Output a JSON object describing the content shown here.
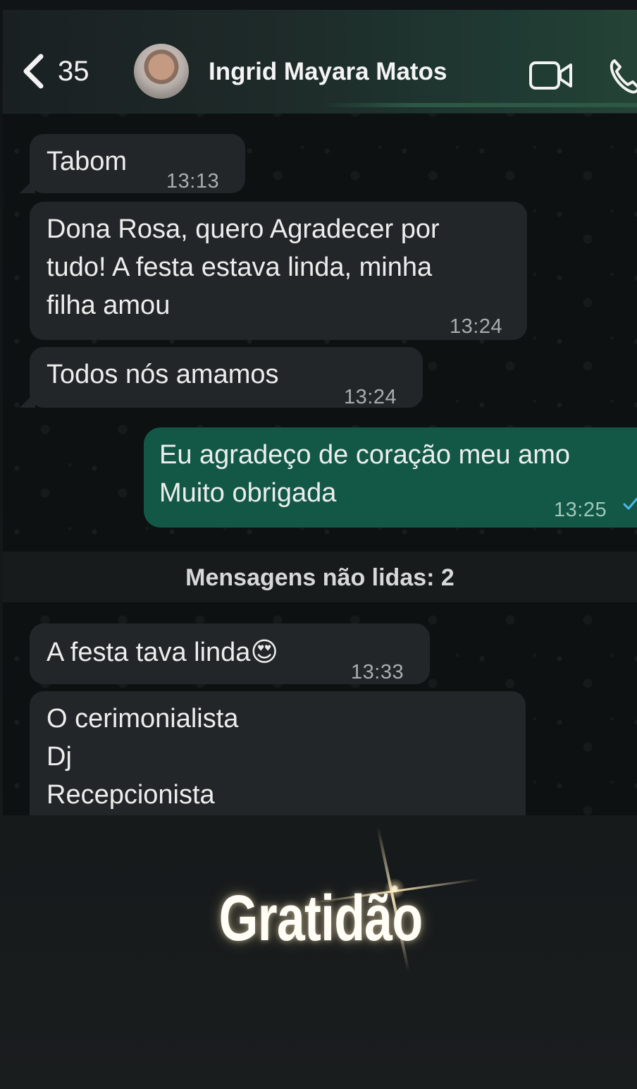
{
  "header": {
    "back_count": "35",
    "contact_name": "Ingrid Mayara Matos"
  },
  "messages": [
    {
      "direction": "in",
      "lines": [
        "Tabom"
      ],
      "time": "13:13"
    },
    {
      "direction": "in",
      "lines": [
        "Dona Rosa, quero Agradecer por",
        "tudo! A festa estava linda, minha",
        "filha amou"
      ],
      "time": "13:24"
    },
    {
      "direction": "in",
      "lines": [
        "Todos nós amamos"
      ],
      "time": "13:24"
    },
    {
      "direction": "out",
      "lines": [
        "Eu agradeço de coração meu amo",
        "Muito obrigada"
      ],
      "time": "13:25",
      "status": "sent"
    },
    {
      "direction": "in",
      "lines": [
        "A festa tava linda😍"
      ],
      "time": "13:33"
    },
    {
      "direction": "in",
      "lines": [
        "O cerimonialista",
        "Dj",
        "Recepcionista"
      ],
      "time": ""
    }
  ],
  "unread_banner": "Mensagens não lidas: 2",
  "overlay_caption": "Gratidão",
  "icons": {
    "back": "chevron-left-icon",
    "video": "video-camera-icon",
    "phone": "phone-icon",
    "read_status": "check-icon"
  },
  "colors": {
    "incoming_bubble": "#232628",
    "outgoing_bubble": "#135847",
    "chat_background": "#0d1112",
    "check": "#4fb6ec"
  }
}
